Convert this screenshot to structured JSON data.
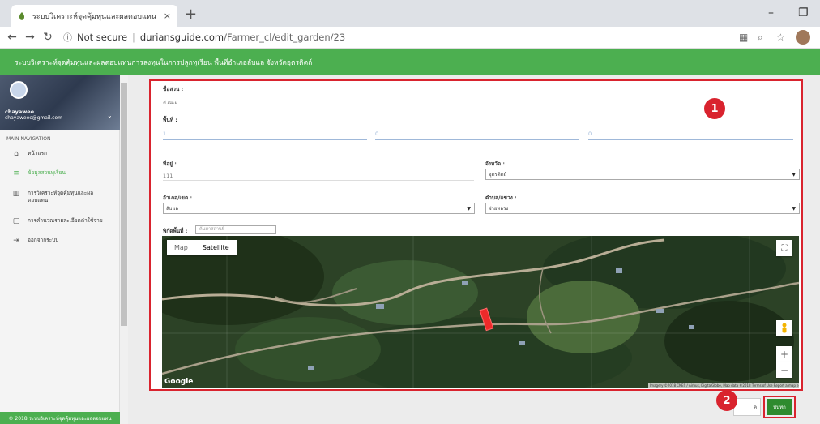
{
  "browser": {
    "tab_title": "ระบบวิเคราะห์จุดคุ้มทุนและผลตอบแทน",
    "new_tab": "+",
    "close_tab": "×",
    "url_security": "Not secure",
    "url_host": "duriansguide.com",
    "url_path": "/Farmer_cl/edit_garden/23"
  },
  "app": {
    "header_title": "ระบบวิเคราะห์จุดคุ้มทุนและผลตอบแทนการลงทุนในการปลูกทุเรียน พื้นที่อำเภอลับแล จังหวัดอุตรดิตถ์"
  },
  "sidebar": {
    "user_name": "chayawee",
    "user_email": "chayaweec@gmail.com",
    "nav_header": "MAIN NAVIGATION",
    "items": [
      {
        "label": "หน้าแรก",
        "icon": "home-icon",
        "glyph": "⌂"
      },
      {
        "label": "ข้อมูลสวนทุเรียน",
        "icon": "list-icon",
        "glyph": "≡"
      },
      {
        "label": "การวิเคราะห์จุดคุ้มทุนและผลตอบแทน",
        "icon": "chart-icon",
        "glyph": "▥"
      },
      {
        "label": "การคำนวณรายละเอียดค่าใช้จ่าย",
        "icon": "file-icon",
        "glyph": "▢"
      },
      {
        "label": "ออกจากระบบ",
        "icon": "signout-icon",
        "glyph": "⇥"
      }
    ],
    "footer": "© 2018 ระบบวิเคราะห์จุดคุ้มทุนและผลตอบแทน"
  },
  "form": {
    "garden_name_label": "ชื่อสวน :",
    "garden_name_value": "สวนเอ",
    "area_label": "พื้นที่ :",
    "area_values": [
      "1",
      "0",
      "0"
    ],
    "address_label": "ที่อยู่ :",
    "address_value": "111",
    "province_label": "จังหวัด :",
    "province_value": "อุตรดิตถ์",
    "district_label": "อำเภอ/เขต :",
    "district_value": "ลับแล",
    "subdistrict_label": "ตำบล/แขวง :",
    "subdistrict_value": "ฝายหลวง",
    "coords_label": "พิกัดพื้นที่ :",
    "search_placeholder": "ค้นหาสถานที่"
  },
  "map": {
    "type_map": "Map",
    "type_satellite": "Satellite",
    "zoom_in": "+",
    "zoom_out": "−",
    "google": "Google",
    "credit": "Imagery ©2018 CNES / Airbus, DigitalGlobe, Map data ©2018  Terms of Use  Report a map error"
  },
  "annotations": {
    "badge_1": "1",
    "badge_2": "2"
  },
  "buttons": {
    "back": "ค",
    "save": "บันทึก"
  },
  "colors": {
    "header_green": "#4caf50",
    "highlight_red": "#d9232e",
    "save_green": "#2e8b2e"
  }
}
